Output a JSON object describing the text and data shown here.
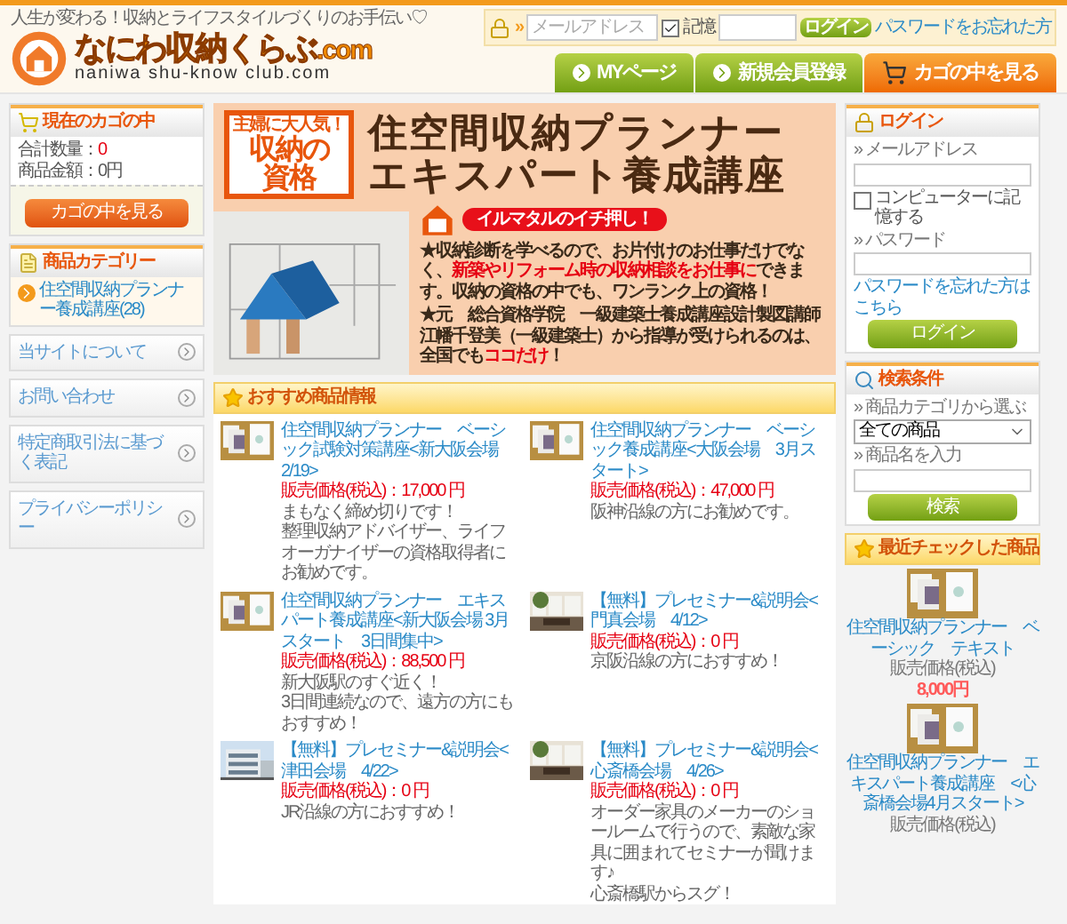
{
  "header": {
    "tagline": "人生が変わる！収納とライフスタイルづくりのお手伝い♡",
    "logo_title": "なにわ収納くらぶ",
    "logo_suffix": ".com",
    "logo_subtitle": "naniwa shu-know club.com",
    "login_bar": {
      "arrow": "»",
      "email_placeholder": "メールアドレス",
      "remember_label": "記憶",
      "remember_checked": true,
      "login_button": "ログイン",
      "forgot_link": "パスワードをお忘れた方"
    }
  },
  "nav": [
    {
      "label": "MYページ",
      "kind": "green"
    },
    {
      "label": "新規会員登録",
      "kind": "green"
    },
    {
      "label": "カゴの中を見る",
      "kind": "cart"
    }
  ],
  "cart_box": {
    "title": "現在のカゴの中",
    "rows": [
      {
        "label": "合計数量：",
        "value": "0",
        "alert": true
      },
      {
        "label": "商品金額：",
        "value": "0円",
        "alert": false
      }
    ],
    "button": "カゴの中を見る"
  },
  "category_box": {
    "title": "商品カテゴリー",
    "items": [
      "住空間収納プランナー養成講座(28)"
    ]
  },
  "side_links": [
    "当サイトについて",
    "お問い合わせ",
    "特定商取引法に基づく表記",
    "プライバシーポリシー"
  ],
  "banner": {
    "badge_top": "主婦に大人気！",
    "badge_lines": [
      "収納の",
      "資格"
    ],
    "title_lines": [
      "住空間収納プランナー",
      "エキスパート養成講座"
    ],
    "bubble": "イルマタルのイチ押し！",
    "paragraphs": [
      [
        {
          "text": "★収納診断を学べるので、お片付けのお仕事だけでなく、",
          "highlight": false
        },
        {
          "text": "新築やリフォーム時の収納相談をお仕事に",
          "highlight": true
        },
        {
          "text": "できます。収納の資格の中でも、ワンランク上の資格！",
          "highlight": false
        }
      ],
      [
        {
          "text": "★元　総合資格学院　一級建築士養成講座設計製図講師江幡千登美（一級建築士）から指導が受けられるのは、全国でも",
          "highlight": false
        },
        {
          "text": "ココだけ",
          "highlight": true
        },
        {
          "text": "！",
          "highlight": false
        }
      ]
    ]
  },
  "recommended": {
    "title": "おすすめ商品情報",
    "items": [
      {
        "title": "住空間収納プランナー　ベーシック試験対策講座<新大阪会場　2/19>",
        "price": "販売価格(税込)：17,000 円",
        "description": [
          "まもなく締め切りです！",
          "整理収納アドバイザー、ライフオーガナイザーの資格取得者にお勧めです。"
        ]
      },
      {
        "title": "住空間収納プランナー　ベーシック養成講座<大阪会場　3月スタート>",
        "price": "販売価格(税込)：47,000 円",
        "description": [
          "阪神沿線の方にお勧めです。"
        ]
      },
      {
        "title": "住空間収納プランナー　エキスパート養成講座<新大阪会場 3月スタート　3日間集中>",
        "price": "販売価格(税込)：88,500 円",
        "description": [
          "新大阪駅のすぐ近く！",
          "3日間連続なので、遠方の方にもおすすめ！"
        ]
      },
      {
        "title": "【無料】プレセミナー&説明会<門真会場　4/12>",
        "price": "販売価格(税込)：0 円",
        "description": [
          "京阪沿線の方におすすめ！"
        ]
      },
      {
        "title": "【無料】プレセミナー&説明会<津田会場　4/22>",
        "price": "販売価格(税込)：0 円",
        "description": [
          "JR沿線の方におすすめ！"
        ]
      },
      {
        "title": "【無料】プレセミナー&説明会<心斎橋会場　4/26>",
        "price": "販売価格(税込)：0 円",
        "description": [
          "オーダー家具のメーカーのショールームで行うので、素敵な家具に囲まれてセミナーが聞けます♪",
          "心斎橋駅からスグ！"
        ]
      }
    ]
  },
  "login_box": {
    "title": "ログイン",
    "email_label": "» メールアドレス",
    "remember_label": "コンピューターに記憶する",
    "remember_checked": false,
    "password_label": "» パスワード",
    "forgot_link": "パスワードを忘れた方はこちら",
    "button": "ログイン"
  },
  "search_box": {
    "title": "検索条件",
    "category_label": "» 商品カテゴリから選ぶ",
    "category_value": "全ての商品",
    "name_label": "» 商品名を入力",
    "button": "検索"
  },
  "recent": {
    "title": "最近チェックした商品",
    "items": [
      {
        "title": "住空間収納プランナー　ベーシック　テキスト",
        "price_label": "販売価格(税込)",
        "price": "8,000円"
      },
      {
        "title": "住空間収納プランナー　エキスパート養成講座　<心斎橋会場4月スタート>",
        "price_label": "販売価格(税込)"
      }
    ]
  }
}
